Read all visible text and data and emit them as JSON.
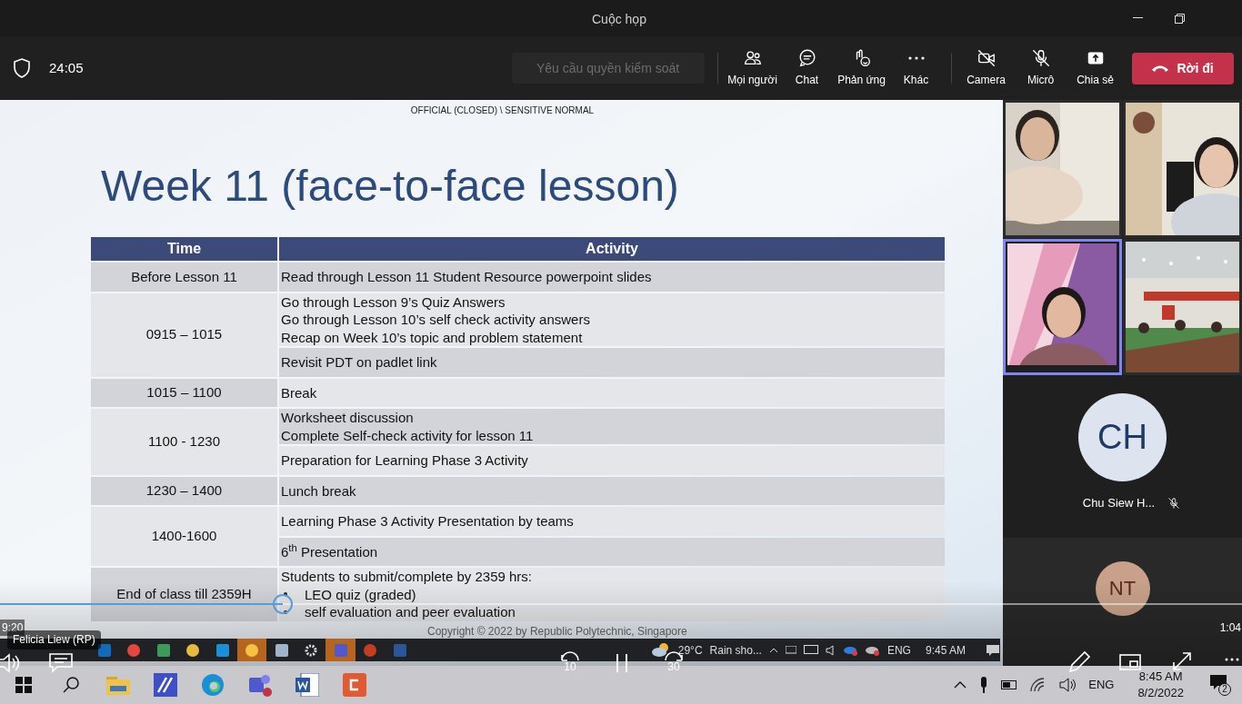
{
  "window": {
    "title": "Cuộc họp"
  },
  "meeting_toolbar": {
    "timer": "24:05",
    "request_control": {
      "label": "Yêu cầu quyền kiểm soát",
      "disabled": true
    },
    "buttons": [
      {
        "label": "Mọi người",
        "kind": "people",
        "off": false
      },
      {
        "label": "Chat",
        "kind": "chat",
        "off": false
      },
      {
        "label": "Phản ứng",
        "kind": "react",
        "off": false
      },
      {
        "label": "Khác",
        "kind": "more",
        "off": false
      },
      {
        "label": "Camera",
        "kind": "camera",
        "off": true
      },
      {
        "label": "Micrô",
        "kind": "mic",
        "off": true
      },
      {
        "label": "Chia sẻ",
        "kind": "share",
        "off": false
      }
    ],
    "leave_button": "Rời đi"
  },
  "slide": {
    "classification": "OFFICIAL (CLOSED) \\ SENSITIVE NORMAL",
    "title": "Week 11 (face-to-face lesson)",
    "table": {
      "columns": [
        "Time",
        "Activity"
      ],
      "rows": [
        {
          "time": "Before Lesson 11",
          "blocks": [
            {
              "lines": [
                "Read through Lesson 11 Student Resource powerpoint slides"
              ]
            }
          ]
        },
        {
          "time": "0915 – 1015",
          "blocks": [
            {
              "lines": [
                "Go through Lesson 9’s Quiz Answers",
                "Go through Lesson 10’s self check activity answers",
                "Recap on Week 10’s topic and problem statement"
              ]
            },
            {
              "lines": [
                "Revisit PDT on padlet link"
              ]
            }
          ]
        },
        {
          "time": "1015 – 1100",
          "blocks": [
            {
              "lines": [
                "Break"
              ]
            }
          ]
        },
        {
          "time": "1100 - 1230",
          "blocks": [
            {
              "lines": [
                "Worksheet discussion",
                "Complete Self-check activity for lesson 11"
              ]
            },
            {
              "lines": [
                "Preparation for Learning Phase 3 Activity"
              ]
            }
          ]
        },
        {
          "time": "1230 – 1400",
          "blocks": [
            {
              "lines": [
                "Lunch break"
              ]
            }
          ]
        },
        {
          "time": "1400-1600",
          "blocks": [
            {
              "lines": [
                "Learning Phase 3 Activity Presentation by teams"
              ]
            },
            {
              "lines": [
                "6$^{th}$ Presentation"
              ]
            }
          ]
        },
        {
          "time": "End of class till 2359H",
          "blocks": [
            {
              "lines": [
                "Students to submit/complete by 2359 hrs:"
              ],
              "bullets": [
                "LEO quiz (graded)",
                "self evaluation and peer evaluation"
              ]
            }
          ]
        }
      ]
    },
    "copyright": "Copyright © 2022 by Republic Polytechnic, Singapore"
  },
  "participants": {
    "video_tiles": [
      {
        "kind": "picture",
        "active_speaker": false
      },
      {
        "kind": "picture",
        "active_speaker": false
      },
      {
        "kind": "picture",
        "active_speaker": true
      },
      {
        "kind": "picture",
        "active_speaker": false
      }
    ],
    "avatars": [
      {
        "initials": "CH",
        "name": "Chu Siew H...",
        "muted": true,
        "color": "#dde4f0"
      },
      {
        "initials": "NT",
        "color": "#c9a18a"
      }
    ]
  },
  "player": {
    "elapsed": "9:20",
    "remaining": "1:04",
    "level": 0.228,
    "speaker_label": "Felicia Liew (RP)",
    "skip_back": "10",
    "skip_forward": "30"
  },
  "shared_taskbar": {
    "temperature": "29°C",
    "forecast": "Rain sho...",
    "language": "ENG",
    "time": "9:45 AM"
  },
  "taskbar": {
    "language": "ENG",
    "time": "8:45 AM",
    "date": "8/2/2022",
    "notifications": "2"
  }
}
